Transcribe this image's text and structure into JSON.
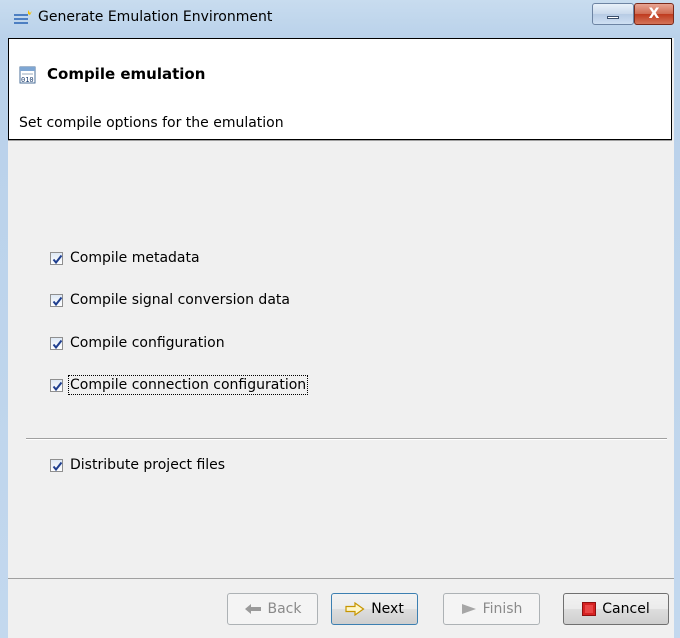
{
  "window": {
    "title": "Generate Emulation Environment",
    "close_glyph": "X"
  },
  "header": {
    "icon": "binary-file-icon",
    "title": "Compile emulation",
    "description": "Set compile options for the emulation"
  },
  "options": [
    {
      "label": "Compile metadata",
      "checked": true
    },
    {
      "label": "Compile signal conversion data",
      "checked": true
    },
    {
      "label": "Compile configuration",
      "checked": true
    },
    {
      "label": "Compile connection configuration",
      "checked": true,
      "focused": true
    }
  ],
  "extra_option": {
    "label": "Distribute project files",
    "checked": true
  },
  "buttons": {
    "back": {
      "label": "Back",
      "enabled": false,
      "icon": "arrow-left-icon"
    },
    "next": {
      "label": "Next",
      "enabled": true,
      "icon": "arrow-right-icon"
    },
    "finish": {
      "label": "Finish",
      "enabled": false,
      "icon": "play-icon"
    },
    "cancel": {
      "label": "Cancel",
      "enabled": true,
      "icon": "stop-icon"
    }
  },
  "colors": {
    "accent": "#3c7fb1",
    "cancel_icon": "#d62222",
    "next_arrow": "#f0b400"
  }
}
